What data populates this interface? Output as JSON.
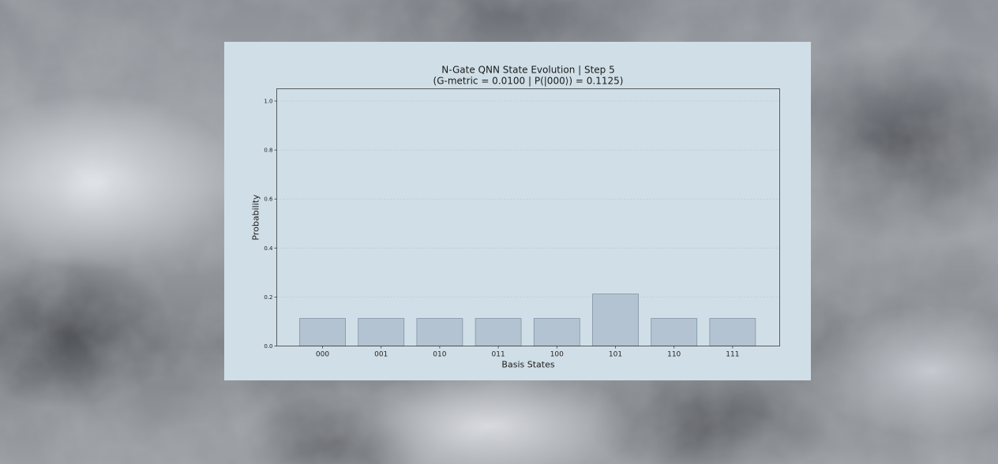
{
  "chart_data": {
    "type": "bar",
    "title": "N-Gate QNN State Evolution | Step 5",
    "subtitle": "(G-metric = 0.0100 | P(|000⟩) = 0.1125)",
    "xlabel": "Basis States",
    "ylabel": "Probability",
    "categories": [
      "000",
      "001",
      "010",
      "011",
      "100",
      "101",
      "110",
      "111"
    ],
    "values": [
      0.1125,
      0.1125,
      0.1125,
      0.1125,
      0.1125,
      0.2125,
      0.1125,
      0.1125
    ],
    "ylim": [
      0,
      1.05
    ],
    "yticks": [
      "0.0",
      "0.2",
      "0.4",
      "0.6",
      "0.8",
      "1.0"
    ],
    "grid": "horizontal, dotted",
    "legend": "none",
    "colors": {
      "bar_fill": "#b3c3d1",
      "bar_edge": "#7f93a6",
      "panel_bg": "#d0dfe7",
      "axes_edge": "#3b3b3b"
    }
  }
}
